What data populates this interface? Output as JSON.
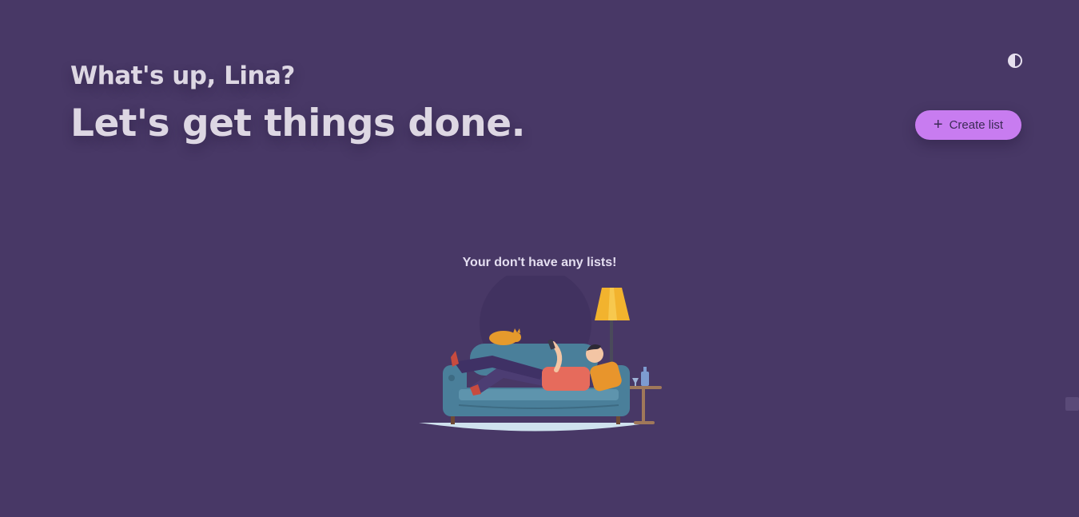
{
  "header": {
    "greeting": "What's up, Lina?",
    "tagline": "Let's get things done."
  },
  "toolbar": {
    "theme_toggle_icon": "contrast-icon",
    "create_list_label": "Create list",
    "create_list_icon": "plus-icon"
  },
  "empty_state": {
    "message": "Your don't have any lists!",
    "illustration": "person-relaxing-on-couch-illustration"
  },
  "colors": {
    "background": "#483866",
    "accent": "#c87cf0",
    "text": "#ddd7e3"
  }
}
